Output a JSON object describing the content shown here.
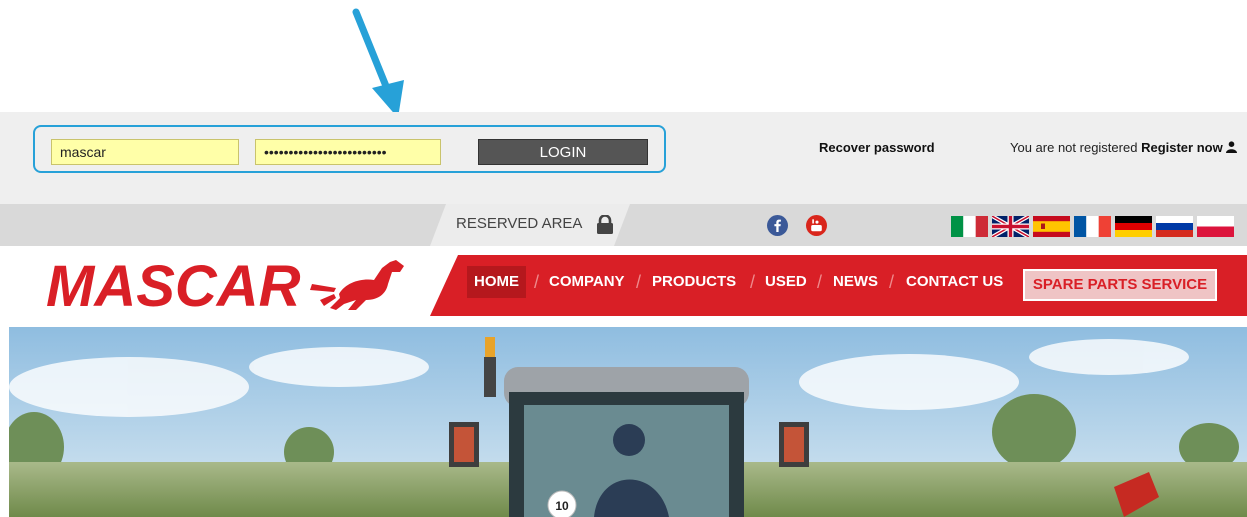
{
  "login": {
    "username_value": "mascar",
    "password_value": "•••••••••••••••••••••••••",
    "button_label": "LOGIN"
  },
  "account": {
    "recover_label": "Recover password",
    "not_registered_text": "You are not registered",
    "register_label": "Register now"
  },
  "reserved": {
    "label": "RESERVED AREA"
  },
  "social": [
    "facebook-icon",
    "youtube-icon"
  ],
  "languages": [
    "Italian",
    "English",
    "Spanish",
    "French",
    "German",
    "Russian",
    "Polish"
  ],
  "brand": {
    "name": "MASCAR"
  },
  "nav": {
    "home": "HOME",
    "company": "COMPANY",
    "products": "PRODUCTS",
    "used": "USED",
    "news": "NEWS",
    "contact": "CONTACT US",
    "spare": "SPARE PARTS SERVICE",
    "separator": "/"
  },
  "hero": {
    "plate": "10"
  },
  "colors": {
    "brand_red": "#d91f26",
    "highlight_blue": "#27a1d8",
    "field_yellow": "#ffffa8",
    "button_gray": "#555555"
  }
}
